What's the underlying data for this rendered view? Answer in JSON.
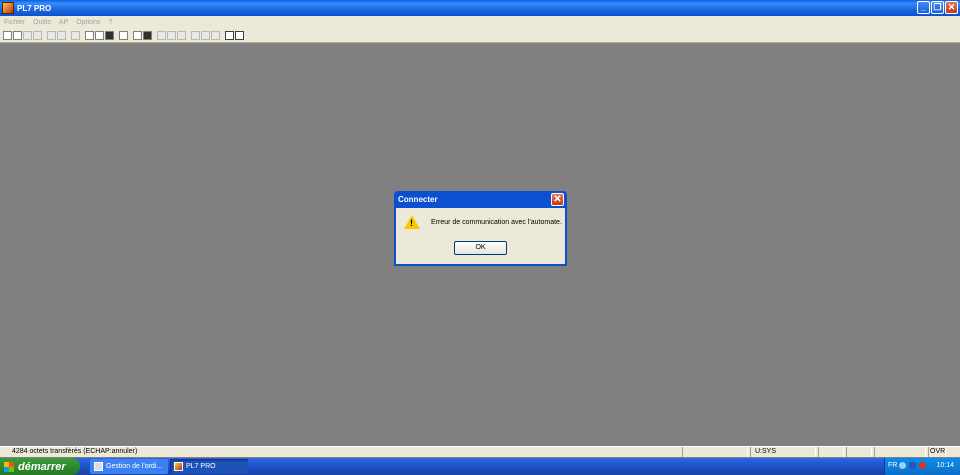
{
  "window": {
    "title": "PL7 PRO"
  },
  "menu": {
    "items": [
      "Fichier",
      "Outils",
      "AP",
      "Options",
      "?"
    ]
  },
  "dialog": {
    "title": "Connecter",
    "message": "Erreur de communication avec l'automate.",
    "ok_label": "OK"
  },
  "statusbar": {
    "message": "4284 octets transférés (ECHAP:annuler)",
    "cell_mode": "U:SYS",
    "cell_ovr": "OVR"
  },
  "taskbar": {
    "start_label": "démarrer",
    "tasks": [
      "Gestion de l'ordi...",
      "PL7 PRO"
    ],
    "lang": "FR",
    "clock": "10:14"
  },
  "icons": [
    "app-icon",
    "minimize-icon",
    "restore-icon",
    "close-icon",
    "warning-icon",
    "windows-logo-icon"
  ]
}
